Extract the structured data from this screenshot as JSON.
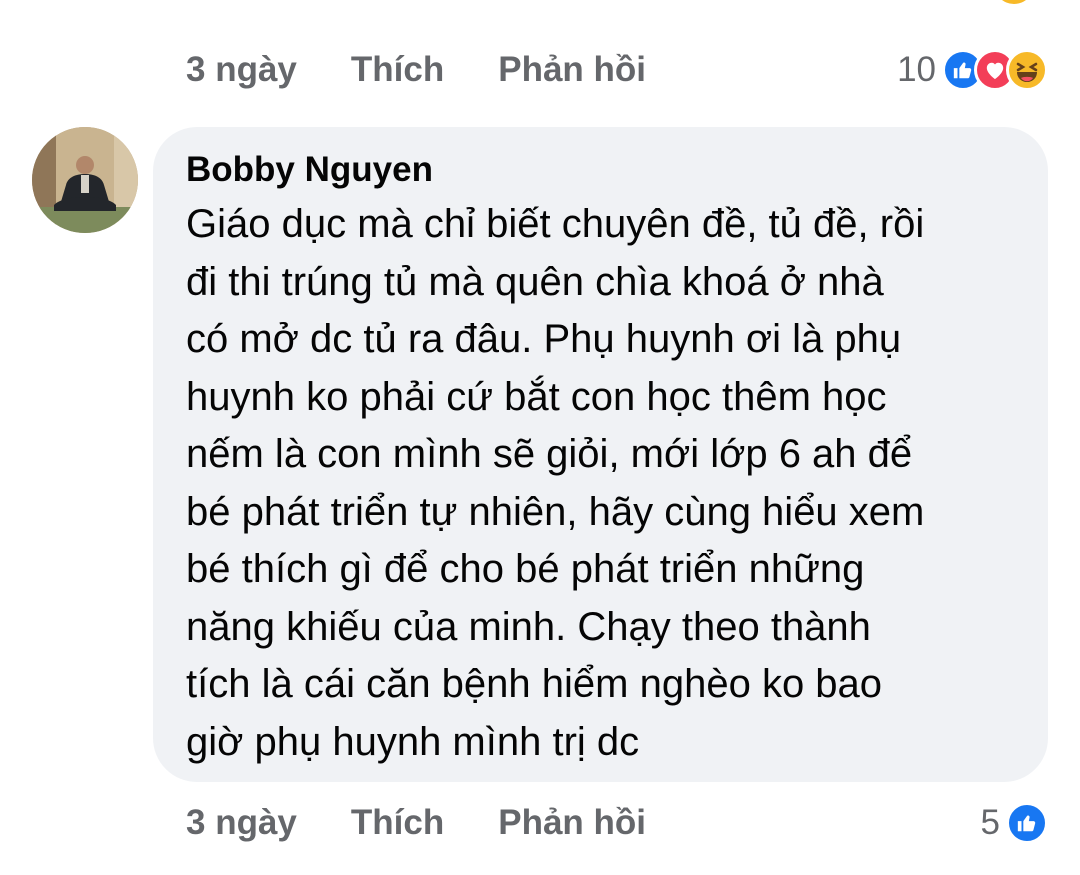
{
  "previous_comment": {
    "time": "3 ngày",
    "like_label": "Thích",
    "reply_label": "Phản hồi",
    "reaction_count": "10",
    "reactions": [
      "like-icon",
      "love-icon",
      "haha-icon"
    ]
  },
  "comment": {
    "author": "Bobby Nguyen",
    "text": "Giáo dục mà chỉ biết chuyên đề, tủ đề, rồi\nđi thi trúng tủ mà quên chìa khoá ở nhà\ncó mở dc tủ ra đâu. Phụ huynh ơi là phụ\nhuynh ko phải cứ bắt con học thêm học\nnếm là con mình sẽ giỏi, mới lớp 6 ah để\nbé phát triển tự nhiên, hãy cùng hiểu xem\nbé thích gì để cho bé phát triển những\nnăng khiếu của minh. Chạy theo thành\ntích là cái căn bệnh hiểm nghèo ko bao\ngiờ phụ huynh mình trị dc",
    "time": "3 ngày",
    "like_label": "Thích",
    "reply_label": "Phản hồi",
    "reaction_count": "5",
    "reactions": [
      "like-icon"
    ]
  },
  "colors": {
    "meta_text": "#65676b",
    "bubble_bg": "#f0f2f5",
    "like": "#1877f2",
    "love": "#f33e58",
    "haha": "#f7b928"
  }
}
